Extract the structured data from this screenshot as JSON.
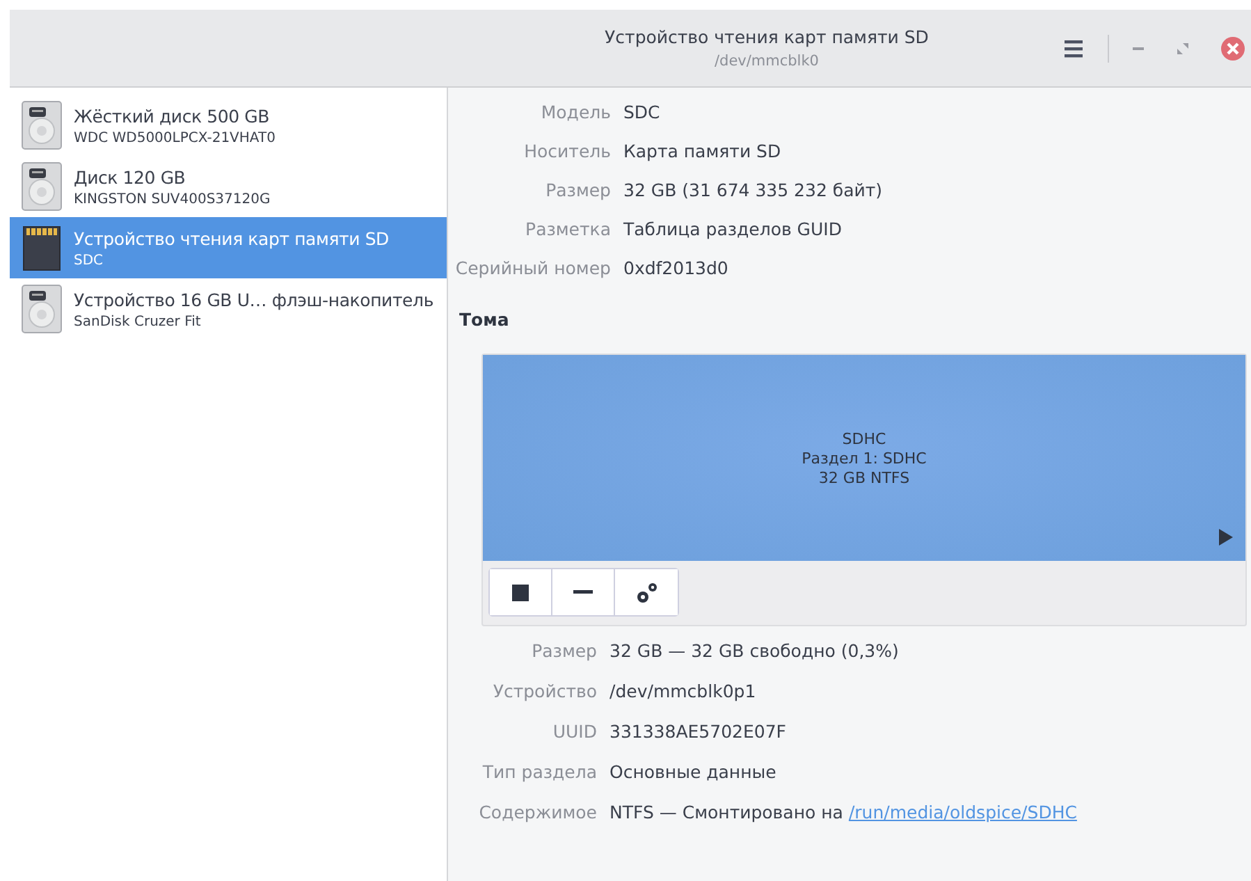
{
  "window": {
    "title": "Устройство чтения карт памяти SD",
    "subtitle": "/dev/mmcblk0"
  },
  "sidebar": {
    "items": [
      {
        "kind": "hdd",
        "title": "Жёсткий диск 500 GB",
        "subtitle": "WDC WD5000LPCX-21VHAT0",
        "selected": false
      },
      {
        "kind": "hdd",
        "title": "Диск 120 GB",
        "subtitle": "KINGSTON SUV400S37120G",
        "selected": false
      },
      {
        "kind": "sdcard",
        "title": "Устройство чтения карт памяти SD",
        "subtitle": "SDC",
        "selected": true
      },
      {
        "kind": "hdd",
        "title": "Устройство 16 GB U… флэш-накопитель",
        "subtitle": "SanDisk Cruzer Fit",
        "selected": false
      }
    ]
  },
  "drive_properties": [
    {
      "label": "Модель",
      "value": "SDC"
    },
    {
      "label": "Носитель",
      "value": "Карта памяти SD"
    },
    {
      "label": "Размер",
      "value": "32 GB (31 674 335 232 байт)"
    },
    {
      "label": "Разметка",
      "value": "Таблица разделов GUID"
    },
    {
      "label": "Серийный номер",
      "value": "0xdf2013d0"
    }
  ],
  "volumes": {
    "heading": "Тома",
    "partition": {
      "lines": [
        "SDHC",
        "Раздел 1: SDHC",
        "32 GB NTFS"
      ],
      "selected": true
    }
  },
  "volume_properties": [
    {
      "label": "Размер",
      "value": "32 GB — 32 GB свободно (0,3%)"
    },
    {
      "label": "Устройство",
      "value": "/dev/mmcblk0p1"
    },
    {
      "label": "UUID",
      "value": "331338AE5702E07F"
    },
    {
      "label": "Тип раздела",
      "value": "Основные данные"
    },
    {
      "label": "Содержимое",
      "value": "NTFS — Смонтировано на",
      "link": "/run/media/oldspice/SDHC"
    }
  ]
}
